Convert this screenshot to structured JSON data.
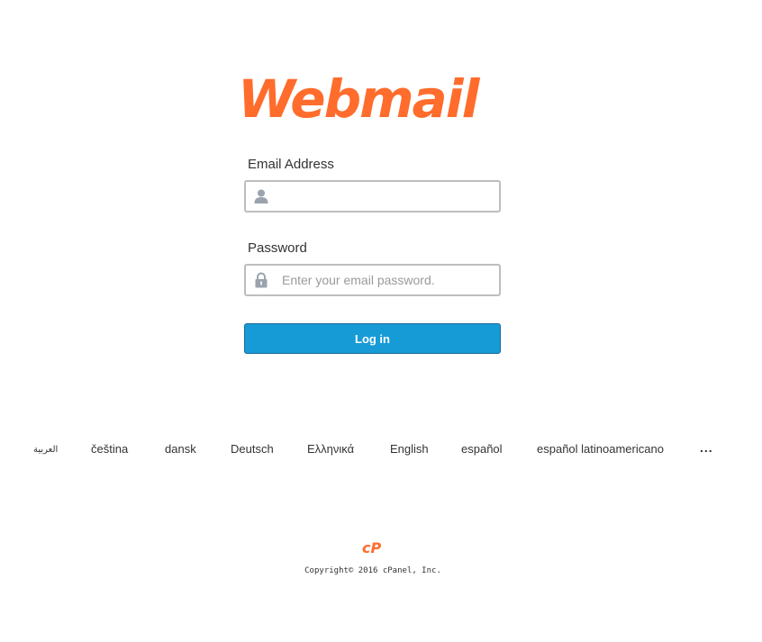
{
  "brand": {
    "logo_text": "Webmail",
    "logo_color": "#ff6c2c",
    "cpanel_logo_text": "cP"
  },
  "login_form": {
    "email_label": "Email Address",
    "email_value": "",
    "email_placeholder": "",
    "email_icon": "user-icon",
    "password_label": "Password",
    "password_value": "",
    "password_placeholder": "Enter your email password.",
    "password_icon": "lock-icon",
    "login_button_label": "Log in",
    "button_color": "#179bd7"
  },
  "languages": [
    "العربية",
    "čeština",
    "dansk",
    "Deutsch",
    "Ελληνικά",
    "English",
    "español",
    "español latinoamericano"
  ],
  "languages_more": "...",
  "footer": {
    "copyright": "Copyright© 2016 cPanel, Inc."
  }
}
